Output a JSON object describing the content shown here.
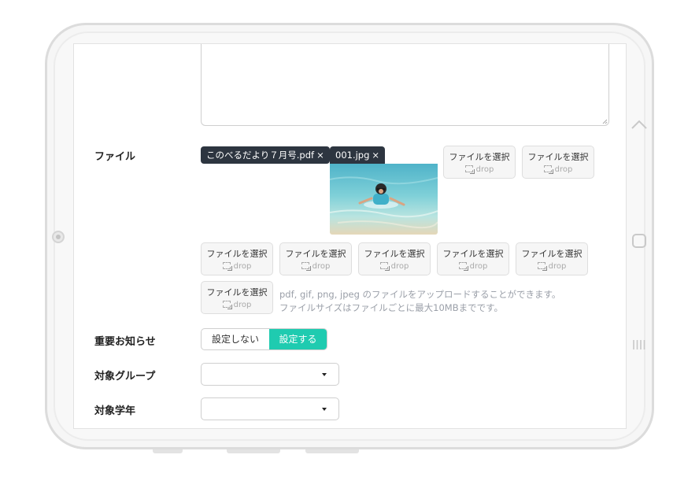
{
  "form": {
    "file": {
      "label": "ファイル",
      "uploaded": [
        {
          "name": "このべるだより７月号.pdf",
          "remove": "×"
        },
        {
          "name": "001.jpg",
          "remove": "×",
          "thumbnail": "photo-child-swimming-in-sea"
        }
      ],
      "slot_label": "ファイルを選択",
      "slot_drop": "drop",
      "empty_slots": 8,
      "help_lines": [
        "pdf, gif, png, jpeg のファイルをアップロードすることができます。",
        "ファイルサイズはファイルごとに最大10MBまでです。"
      ]
    },
    "important": {
      "label": "重要お知らせ",
      "options": [
        "設定しない",
        "設定する"
      ],
      "selected": "設定する"
    },
    "target_group": {
      "label": "対象グループ",
      "value": ""
    },
    "target_grade": {
      "label": "対象学年",
      "value": ""
    }
  },
  "theme": {
    "accent": "#1fcbb0",
    "tag_bg": "#2d3540"
  },
  "device": {
    "side_icons": [
      "chevron-up-icon",
      "home-square-icon",
      "recent-apps-icon"
    ]
  }
}
